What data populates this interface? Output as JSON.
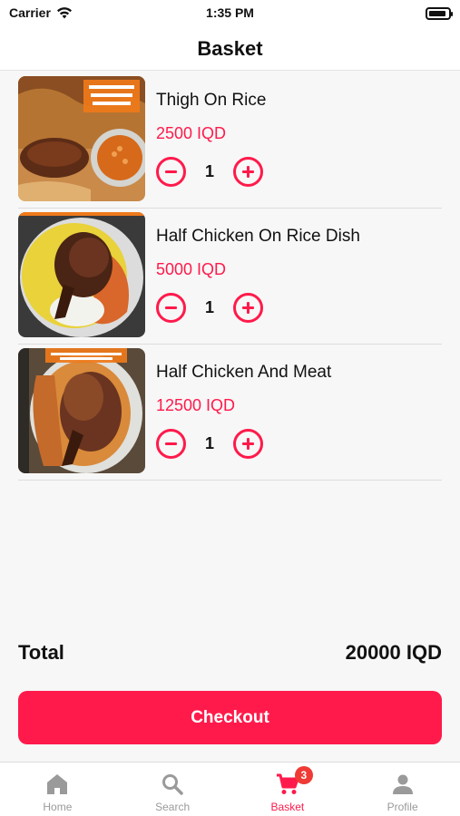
{
  "status_bar": {
    "carrier": "Carrier",
    "time": "1:35 PM"
  },
  "header": {
    "title": "Basket"
  },
  "items": [
    {
      "name": "Thigh On Rice",
      "price": "2500 IQD",
      "quantity": "1"
    },
    {
      "name": "Half Chicken On Rice Dish",
      "price": "5000 IQD",
      "quantity": "1"
    },
    {
      "name": "Half Chicken And Meat",
      "price": "12500 IQD",
      "quantity": "1"
    }
  ],
  "total": {
    "label": "Total",
    "amount": "20000 IQD"
  },
  "checkout": {
    "label": "Checkout"
  },
  "tabs": [
    {
      "label": "Home",
      "icon": "home-icon"
    },
    {
      "label": "Search",
      "icon": "search-icon"
    },
    {
      "label": "Basket",
      "icon": "cart-icon",
      "badge": "3",
      "active": true
    },
    {
      "label": "Profile",
      "icon": "person-icon"
    }
  ],
  "colors": {
    "accent": "#ff1a4b",
    "badge": "#f03a35",
    "inactive_tab": "#9a9a9a"
  }
}
